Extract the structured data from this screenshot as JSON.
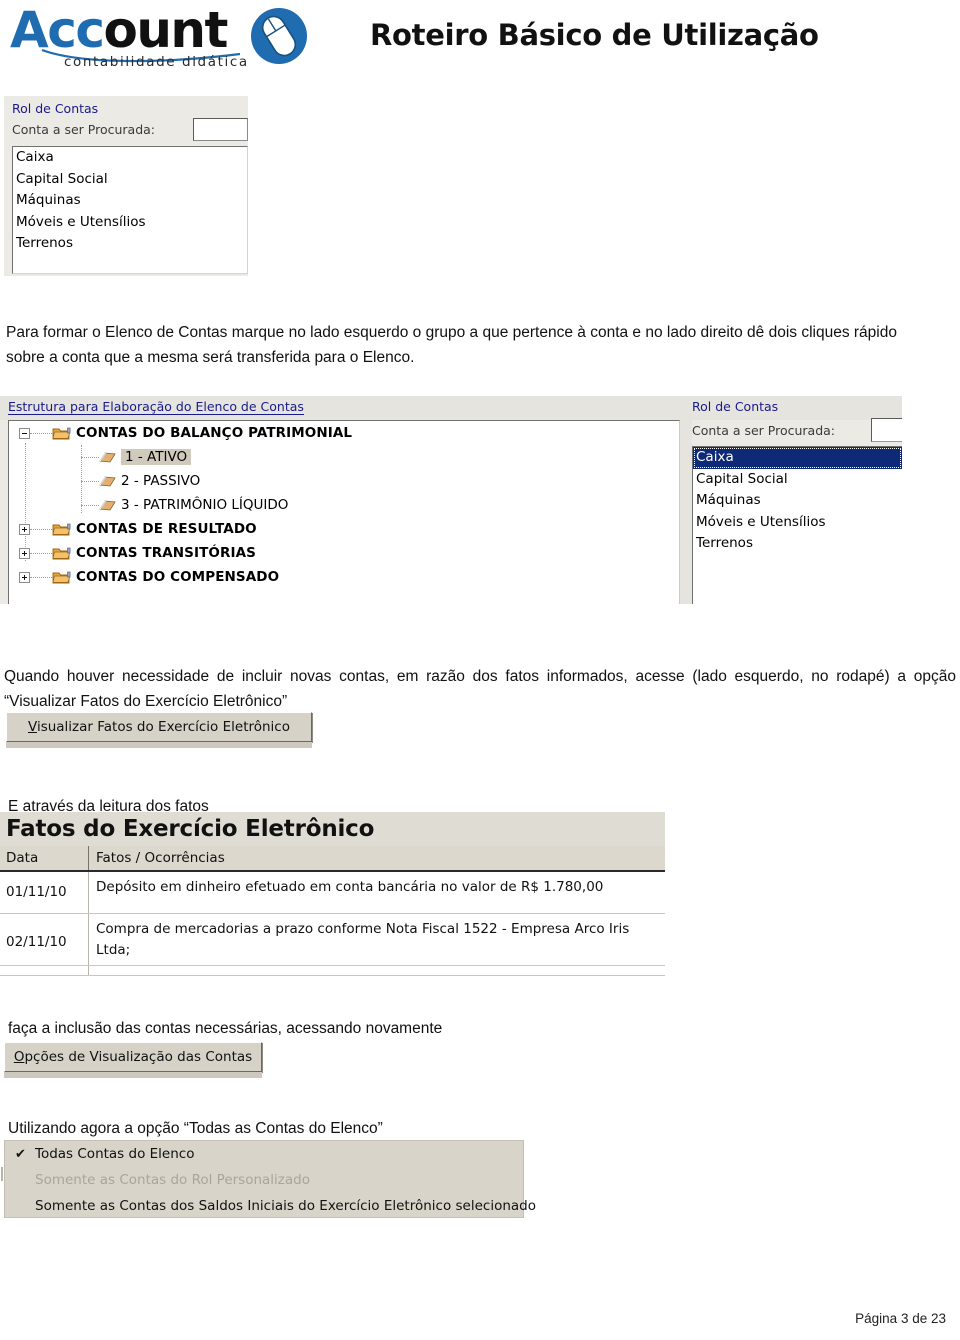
{
  "header": {
    "logo_word_part1": "Acc",
    "logo_word_part2": "ount",
    "logo_subtitle": "contabilidade didática",
    "logo_icon": "mouse-icon",
    "document_title": "Roteiro Básico de Utilização",
    "brand_color": "#1f6cb0"
  },
  "rol_widget_top": {
    "title": "Rol de Contas",
    "search_label": "Conta a ser Procurada:",
    "search_value": "",
    "search_placeholder": "",
    "accounts": [
      "Caixa",
      "Capital Social",
      "Máquinas",
      "Móveis e Utensílios",
      "Terrenos"
    ],
    "selected_index": -1
  },
  "paragraph_1": "Para formar o Elenco de Contas marque no lado esquerdo o grupo a que pertence à conta e no lado direito dê dois cliques rápido sobre a conta que a mesma será transferida para o Elenco.",
  "estrutura_widget": {
    "tree_title": "Estrutura para Elaboração do Elenco de Contas",
    "tree_nodes": [
      {
        "label": "CONTAS DO BALANÇO PATRIMONIAL",
        "level": 0,
        "type": "group",
        "expander": "minus",
        "icon": "folder-icon",
        "selected": false
      },
      {
        "label": "1 - ATIVO",
        "level": 1,
        "type": "leaf",
        "expander": "none",
        "icon": "book-icon",
        "selected": true
      },
      {
        "label": "2 - PASSIVO",
        "level": 1,
        "type": "leaf",
        "expander": "none",
        "icon": "book-icon",
        "selected": false
      },
      {
        "label": "3 - PATRIMÔNIO LÍQUIDO",
        "level": 1,
        "type": "leaf",
        "expander": "none",
        "icon": "book-icon",
        "selected": false
      },
      {
        "label": "CONTAS DE RESULTADO",
        "level": 0,
        "type": "group",
        "expander": "plus",
        "icon": "folder-icon",
        "selected": false
      },
      {
        "label": "CONTAS TRANSITÓRIAS",
        "level": 0,
        "type": "group",
        "expander": "plus",
        "icon": "folder-icon",
        "selected": false
      },
      {
        "label": "CONTAS DO COMPENSADO",
        "level": 0,
        "type": "group",
        "expander": "plus",
        "icon": "folder-icon",
        "selected": false
      }
    ],
    "rol_title": "Rol de Contas",
    "rol_search_label": "Conta a ser Procurada:",
    "rol_search_value": "",
    "rol_accounts": [
      "Caixa",
      "Capital Social",
      "Máquinas",
      "Móveis e Utensílios",
      "Terrenos"
    ],
    "rol_selected_index": 0,
    "selection_color": "#0e2a77"
  },
  "paragraph_2": "Quando houver necessidade de incluir novas contas, em razão dos fatos informados, acesse (lado esquerdo, no rodapé) a opção “Visualizar Fatos do Exercício Eletrônico”",
  "button_visualizar": {
    "accel": "V",
    "label_rest": "isualizar Fatos do Exercício Eletrônico"
  },
  "paragraph_3": "E através da leitura dos fatos",
  "fatos_table": {
    "title": "Fatos do Exercício Eletrônico",
    "columns": [
      "Data",
      "Fatos / Ocorrências"
    ],
    "rows": [
      {
        "data": "01/11/10",
        "fato": "Depósito em dinheiro efetuado em conta bancária no valor de R$ 1.780,00"
      },
      {
        "data": "02/11/10",
        "fato": "Compra de mercadorias a prazo conforme Nota Fiscal 1522 - Empresa Arco Iris Ltda;"
      }
    ]
  },
  "paragraph_4": "faça a inclusão das contas necessárias, acessando novamente",
  "button_opcoes": {
    "accel": "O",
    "label_rest": "pções de Visualização das Contas"
  },
  "paragraph_5": "Utilizando agora a opção “Todas as Contas do Elenco”",
  "opcoes_menu": {
    "items": [
      {
        "label": "Todas Contas do Elenco",
        "checked": true,
        "check_glyph": "✔",
        "disabled": false
      },
      {
        "label": "Somente as Contas do Rol Personalizado",
        "checked": false,
        "check_glyph": "",
        "disabled": true
      },
      {
        "label": "Somente as Contas dos Saldos Iniciais do Exercício Eletrônico selecionado",
        "checked": false,
        "check_glyph": "",
        "disabled": false
      }
    ]
  },
  "footer": {
    "page_text": "Página 3 de 23"
  }
}
